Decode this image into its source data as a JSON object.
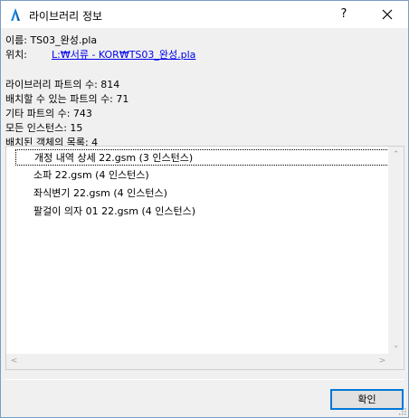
{
  "window": {
    "title": "라이브러리 정보",
    "help_label": "?",
    "app_icon": "archicad-icon",
    "close_icon": "close-icon"
  },
  "info": {
    "name_line": "이름: TS03_완성.pla",
    "location_label": "위치:",
    "location_value": "L:₩서류 - KOR₩TS03_완성.pla",
    "library_parts": "라이브러리 파트의 수: 814",
    "placeable_parts": "배치할 수 있는 파트의 수: 71",
    "other_parts": "기타 파트의 수: 743",
    "all_instances": "모든 인스턴스: 15",
    "placed_objects": "배치된 객체의 목록: 4"
  },
  "list": {
    "items": [
      "개정 내역 상세 22.gsm (3 인스턴스)",
      "소파 22.gsm (4 인스턴스)",
      "좌식변기 22.gsm (4 인스턴스)",
      "팔걸이 의자 01 22.gsm (4 인스턴스)"
    ],
    "selected_index": 0
  },
  "buttons": {
    "ok_label": "확인"
  }
}
